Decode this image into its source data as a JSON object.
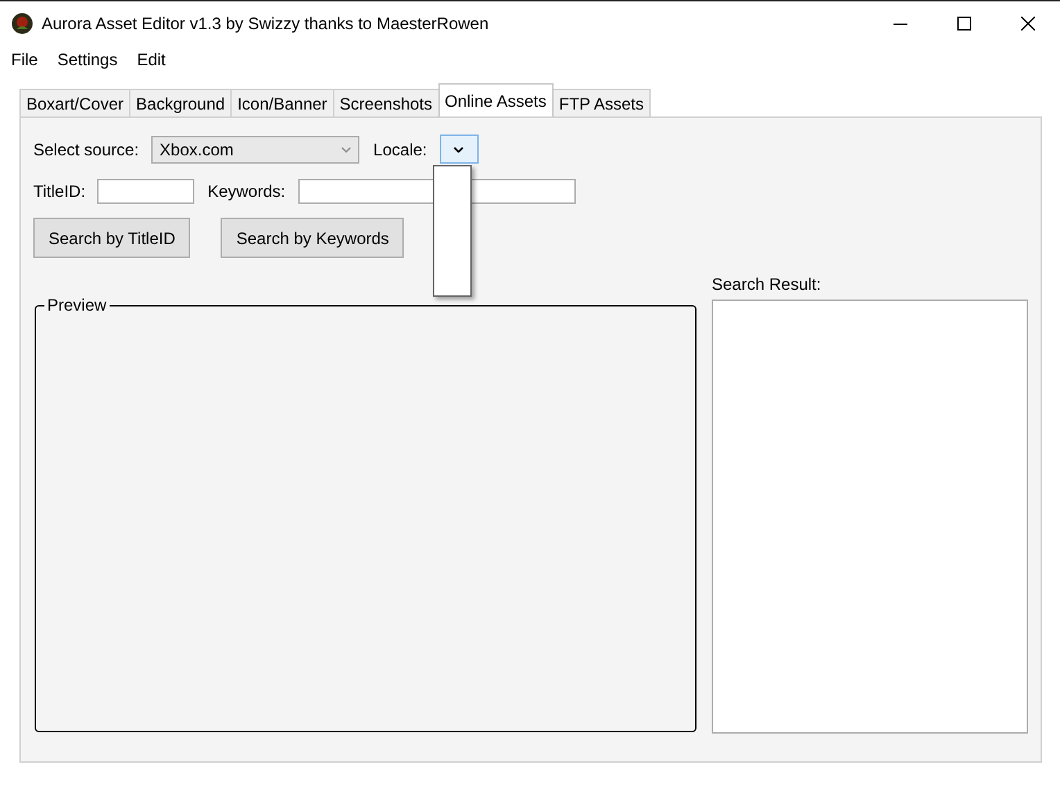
{
  "window": {
    "title": "Aurora Asset Editor v1.3 by Swizzy thanks to MaesterRowen"
  },
  "menu": [
    "File",
    "Settings",
    "Edit"
  ],
  "tabs": [
    {
      "label": "Boxart/Cover",
      "selected": false
    },
    {
      "label": "Background",
      "selected": false
    },
    {
      "label": "Icon/Banner",
      "selected": false
    },
    {
      "label": "Screenshots",
      "selected": false
    },
    {
      "label": "Online Assets",
      "selected": true
    },
    {
      "label": "FTP Assets",
      "selected": false
    }
  ],
  "source": {
    "label": "Select source:",
    "value": "Xbox.com"
  },
  "locale": {
    "label": "Locale:",
    "expanded": true
  },
  "title_id": {
    "label": "TitleID:"
  },
  "keywords": {
    "label": "Keywords:"
  },
  "buttons": [
    "Search by TitleID",
    "Search by Keywords"
  ],
  "preview": {
    "label": "Preview"
  },
  "search_result": {
    "label": "Search Result:"
  }
}
